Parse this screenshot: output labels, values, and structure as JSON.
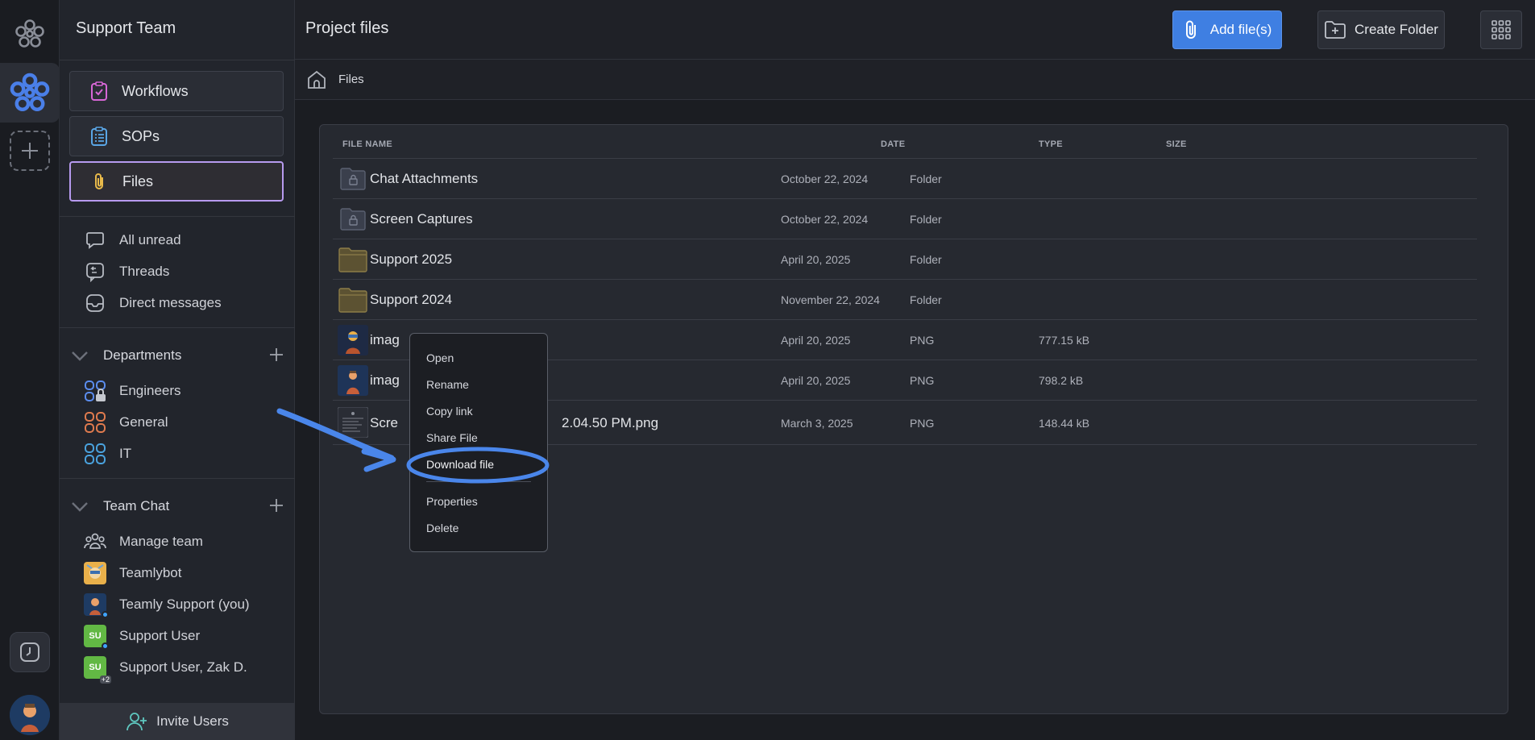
{
  "rail": {
    "logo_icon": "flower-logo-icon",
    "workspace_icon": "teamly-workspace-icon",
    "add_icon": "plus-icon",
    "clock_icon": "clock-icon"
  },
  "sidebar": {
    "team_name": "Support Team",
    "nav_cards": [
      {
        "label": "Workflows",
        "icon": "clipboard-check-icon"
      },
      {
        "label": "SOPs",
        "icon": "list-clipboard-icon"
      },
      {
        "label": "Files",
        "icon": "paperclip-icon",
        "active": true
      }
    ],
    "inbox": [
      {
        "label": "All unread",
        "icon": "chat-bubble-icon"
      },
      {
        "label": "Threads",
        "icon": "thread-icon"
      },
      {
        "label": "Direct messages",
        "icon": "inbox-icon"
      }
    ],
    "departments": {
      "title": "Departments",
      "items": [
        {
          "label": "Engineers",
          "color": "#5b8def"
        },
        {
          "label": "General",
          "color": "#e07b4e"
        },
        {
          "label": "IT",
          "color": "#4aa3df"
        }
      ]
    },
    "team_chat": {
      "title": "Team Chat",
      "items": [
        {
          "label": "Manage team",
          "icon": "team-icon"
        },
        {
          "label": "Teamlybot",
          "icon": "bot-avatar"
        },
        {
          "label": "Teamly Support (you)",
          "icon": "user-avatar"
        },
        {
          "label": "Support User",
          "badge": "SU"
        },
        {
          "label": "Support User, Zak D.",
          "badge": "SU",
          "extra": "+2"
        }
      ]
    },
    "invite_label": "Invite Users"
  },
  "header": {
    "title": "Project files",
    "add_files_label": "Add file(s)",
    "create_folder_label": "Create Folder"
  },
  "breadcrumb": {
    "label": "Files"
  },
  "table": {
    "columns": [
      "FILE NAME",
      "DATE",
      "TYPE",
      "SIZE"
    ],
    "rows": [
      {
        "name": "Chat Attachments",
        "date": "October 22, 2024",
        "type": "Folder",
        "size": "",
        "kind": "locked-folder"
      },
      {
        "name": "Screen Captures",
        "date": "October 22, 2024",
        "type": "Folder",
        "size": "",
        "kind": "locked-folder"
      },
      {
        "name": "Support 2025",
        "date": "April 20, 2025",
        "type": "Folder",
        "size": "",
        "kind": "folder"
      },
      {
        "name": "Support 2024",
        "date": "November 22, 2024",
        "type": "Folder",
        "size": "",
        "kind": "folder"
      },
      {
        "name": "imag",
        "date": "April 20, 2025",
        "type": "PNG",
        "size": "777.15 kB",
        "kind": "image"
      },
      {
        "name": "imag",
        "date": "April 20, 2025",
        "type": "PNG",
        "size": "798.2 kB",
        "kind": "image"
      },
      {
        "name": "Scre",
        "name_tail": "2.04.50 PM.png",
        "date": "March 3, 2025",
        "type": "PNG",
        "size": "148.44 kB",
        "kind": "screenshot"
      }
    ]
  },
  "context_menu": {
    "items": [
      "Open",
      "Rename",
      "Copy link",
      "Share File",
      "Download file",
      "Properties",
      "Delete"
    ],
    "highlighted": "Download file",
    "annotation_color": "#3f7fe2"
  }
}
